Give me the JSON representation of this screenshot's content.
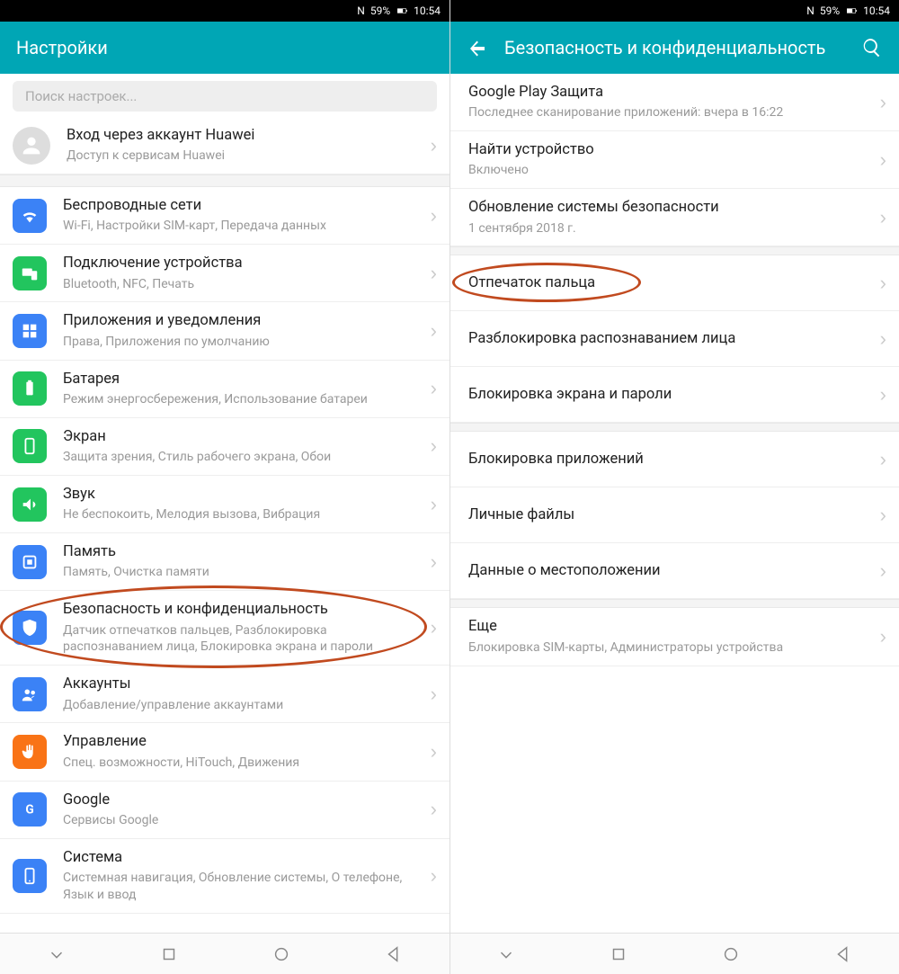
{
  "status": {
    "nfc": "N",
    "battery_pct": "59%",
    "time": "10:54"
  },
  "left": {
    "title": "Настройки",
    "search_placeholder": "Поиск настроек...",
    "account": {
      "title": "Вход через аккаунт Huawei",
      "sub": "Доступ к сервисам Huawei"
    },
    "items": [
      {
        "title": "Беспроводные сети",
        "sub": "Wi-Fi, Настройки SIM-карт, Передача данных"
      },
      {
        "title": "Подключение устройства",
        "sub": "Bluetooth, NFC, Печать"
      },
      {
        "title": "Приложения и уведомления",
        "sub": "Права, Приложения по умолчанию"
      },
      {
        "title": "Батарея",
        "sub": "Режим энергосбережения, Использование батареи"
      },
      {
        "title": "Экран",
        "sub": "Защита зрения, Стиль рабочего экрана, Обои"
      },
      {
        "title": "Звук",
        "sub": "Не беспокоить, Мелодия вызова, Вибрация"
      },
      {
        "title": "Память",
        "sub": "Память, Очистка памяти"
      },
      {
        "title": "Безопасность и конфиденциальность",
        "sub": "Датчик отпечатков пальцев, Разблокировка распознаванием лица, Блокировка экрана и пароли"
      },
      {
        "title": "Аккаунты",
        "sub": "Добавление/управление аккаунтами"
      },
      {
        "title": "Управление",
        "sub": "Спец. возможности, HiTouch, Движения"
      },
      {
        "title": "Google",
        "sub": "Сервисы Google"
      },
      {
        "title": "Система",
        "sub": "Системная навигация, Обновление системы, О телефоне, Язык и ввод"
      }
    ]
  },
  "right": {
    "title": "Безопасность и конфиденциальность",
    "groups": [
      [
        {
          "title": "Google Play Защита",
          "sub": "Последнее сканирование приложений: вчера в 16:22"
        },
        {
          "title": "Найти устройство",
          "sub": "Включено"
        },
        {
          "title": "Обновление системы безопасности",
          "sub": "1 сентября 2018 г."
        }
      ],
      [
        {
          "title": "Отпечаток пальца"
        },
        {
          "title": "Разблокировка распознаванием лица"
        },
        {
          "title": "Блокировка экрана и пароли"
        }
      ],
      [
        {
          "title": "Блокировка приложений"
        },
        {
          "title": "Личные файлы"
        },
        {
          "title": "Данные о местоположении"
        }
      ],
      [
        {
          "title": "Еще",
          "sub": "Блокировка SIM-карты, Администраторы устройства"
        }
      ]
    ]
  }
}
